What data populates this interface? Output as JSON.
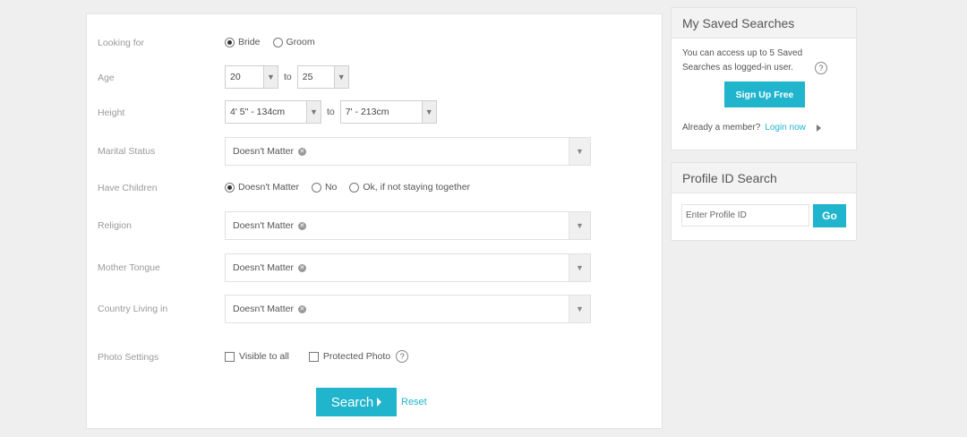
{
  "form": {
    "looking_for": {
      "label": "Looking for",
      "options": [
        "Bride",
        "Groom"
      ],
      "selected": "Bride"
    },
    "age": {
      "label": "Age",
      "from": "20",
      "to_text": "to",
      "to": "25"
    },
    "height": {
      "label": "Height",
      "from": "4' 5\" - 134cm",
      "to_text": "to",
      "to": "7' - 213cm"
    },
    "marital_status": {
      "label": "Marital Status",
      "value": "Doesn't Matter"
    },
    "have_children": {
      "label": "Have Children",
      "options": [
        "Doesn't Matter",
        "No",
        "Ok, if not staying together"
      ],
      "selected": "Doesn't Matter"
    },
    "religion": {
      "label": "Religion",
      "value": "Doesn't Matter"
    },
    "mother_tongue": {
      "label": "Mother Tongue",
      "value": "Doesn't Matter"
    },
    "country": {
      "label": "Country Living in",
      "value": "Doesn't Matter"
    },
    "photo_settings": {
      "label": "Photo Settings",
      "options": [
        "Visible to all",
        "Protected Photo"
      ],
      "help": "?"
    },
    "search_label": "Search",
    "reset_label": "Reset"
  },
  "saved_searches": {
    "title": "My Saved Searches",
    "text": "You can access up to 5 Saved Searches as logged-in user.",
    "help": "?",
    "signup_label": "Sign Up Free",
    "member_text": "Already a member?",
    "login_label": "Login now"
  },
  "profile_search": {
    "title": "Profile ID Search",
    "placeholder": "Enter Profile ID",
    "go_label": "Go"
  },
  "colors": {
    "accent": "#20b5cc",
    "background": "#efefef"
  }
}
